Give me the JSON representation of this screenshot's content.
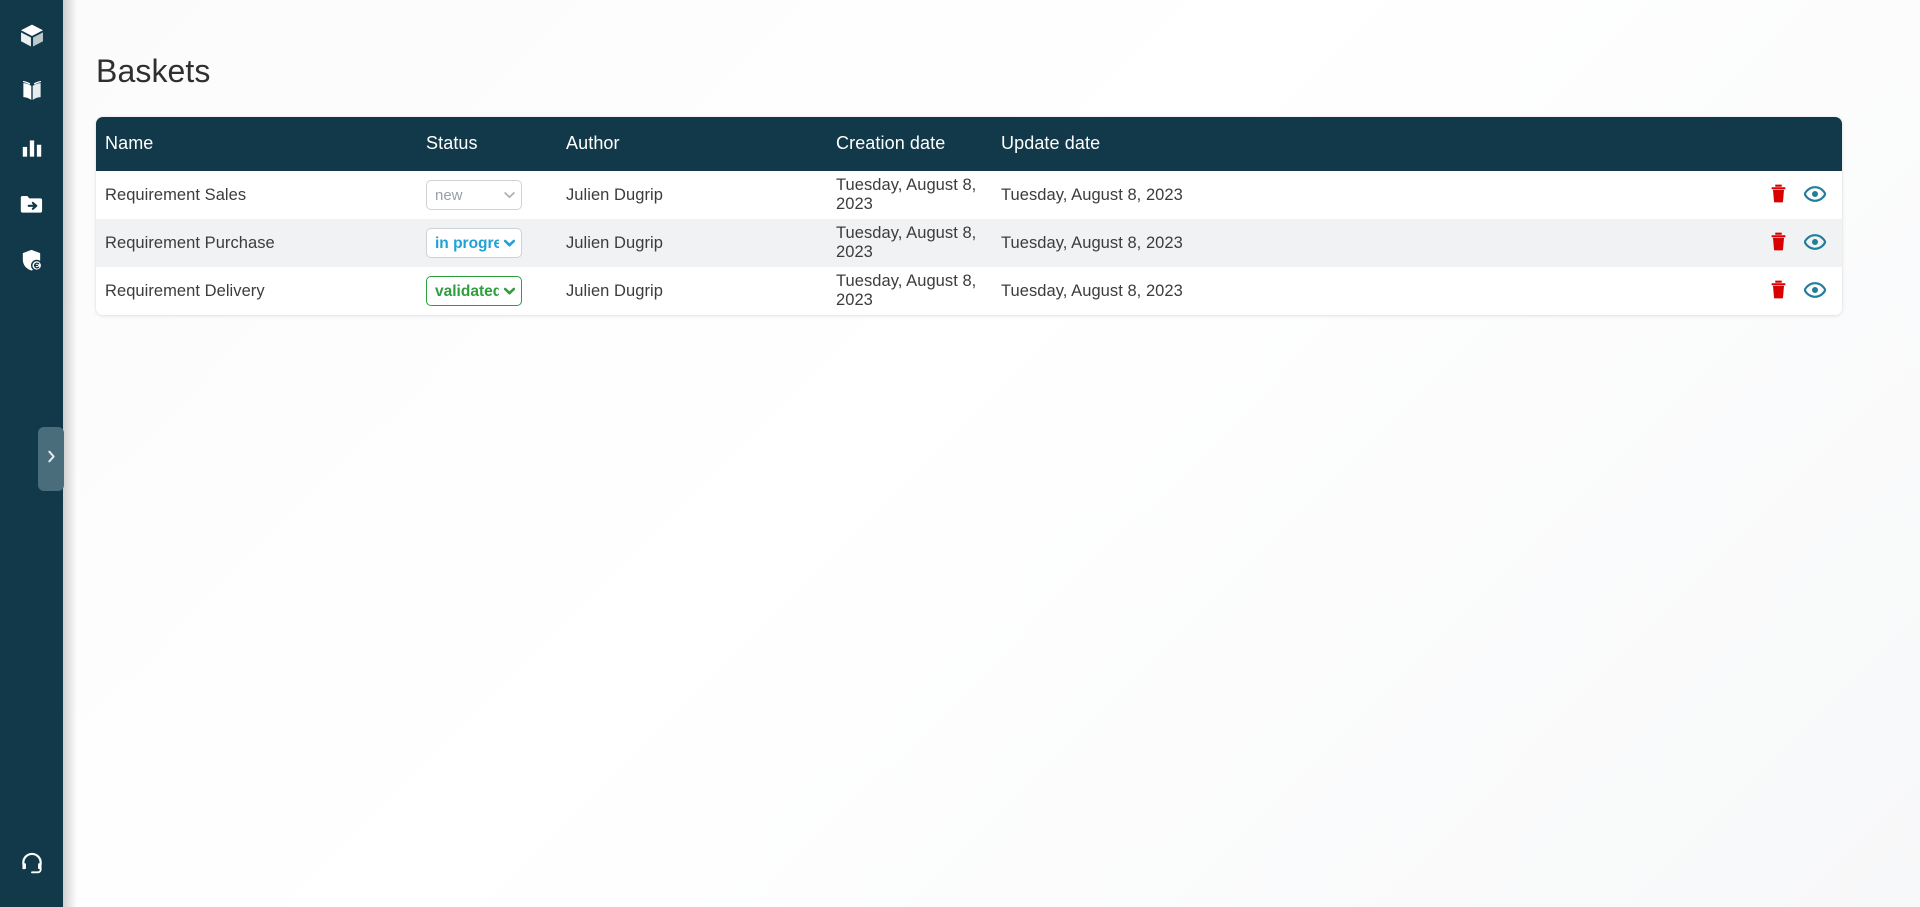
{
  "theme": {
    "sidebar_bg": "#12394a",
    "table_header_bg": "#12394a",
    "page_bg": "#ffffff",
    "stripe_bg": "#f1f2f3",
    "delete_icon_color": "#d80000",
    "view_icon_color": "#1f7e99",
    "status_new_color": "#9aa0a6",
    "status_in_progress_color": "#1fa2d6",
    "status_validated_color": "#2e9e3e",
    "toggle_handle_bg": "#4a6d7c"
  },
  "sidebar": {
    "items": [
      {
        "icon": "cube-icon",
        "name": "sidebar-item-products"
      },
      {
        "icon": "open-book-icon",
        "name": "sidebar-item-catalog"
      },
      {
        "icon": "bar-chart-icon",
        "name": "sidebar-item-reports"
      },
      {
        "icon": "folder-arrow-icon",
        "name": "sidebar-item-baskets"
      },
      {
        "icon": "shield-euro-icon",
        "name": "sidebar-item-compliance"
      }
    ],
    "bottom": {
      "icon": "headset-support-icon",
      "name": "sidebar-item-support"
    },
    "toggle": {
      "icon": "chevron-right-icon",
      "name": "sidebar-toggle"
    }
  },
  "page": {
    "title": "Baskets"
  },
  "table": {
    "columns": [
      {
        "key": "name",
        "label": "Name"
      },
      {
        "key": "status",
        "label": "Status"
      },
      {
        "key": "author",
        "label": "Author"
      },
      {
        "key": "creation",
        "label": "Creation date"
      },
      {
        "key": "update",
        "label": "Update date"
      },
      {
        "key": "actions",
        "label": ""
      }
    ],
    "status_options": [
      "new",
      "in progress",
      "validated"
    ],
    "rows": [
      {
        "name": "Requirement Sales",
        "status": "new",
        "author": "Julien Dugrip",
        "creation_date": "Tuesday, August 8, 2023",
        "update_date": "Tuesday, August 8, 2023",
        "delete_label": "delete-icon",
        "view_label": "eye-icon"
      },
      {
        "name": "Requirement Purchase",
        "status": "in progress",
        "author": "Julien Dugrip",
        "creation_date": "Tuesday, August 8, 2023",
        "update_date": "Tuesday, August 8, 2023",
        "delete_label": "delete-icon",
        "view_label": "eye-icon"
      },
      {
        "name": "Requirement Delivery",
        "status": "validated",
        "author": "Julien Dugrip",
        "creation_date": "Tuesday, August 8, 2023",
        "update_date": "Tuesday, August 8, 2023",
        "delete_label": "delete-icon",
        "view_label": "eye-icon"
      }
    ]
  }
}
